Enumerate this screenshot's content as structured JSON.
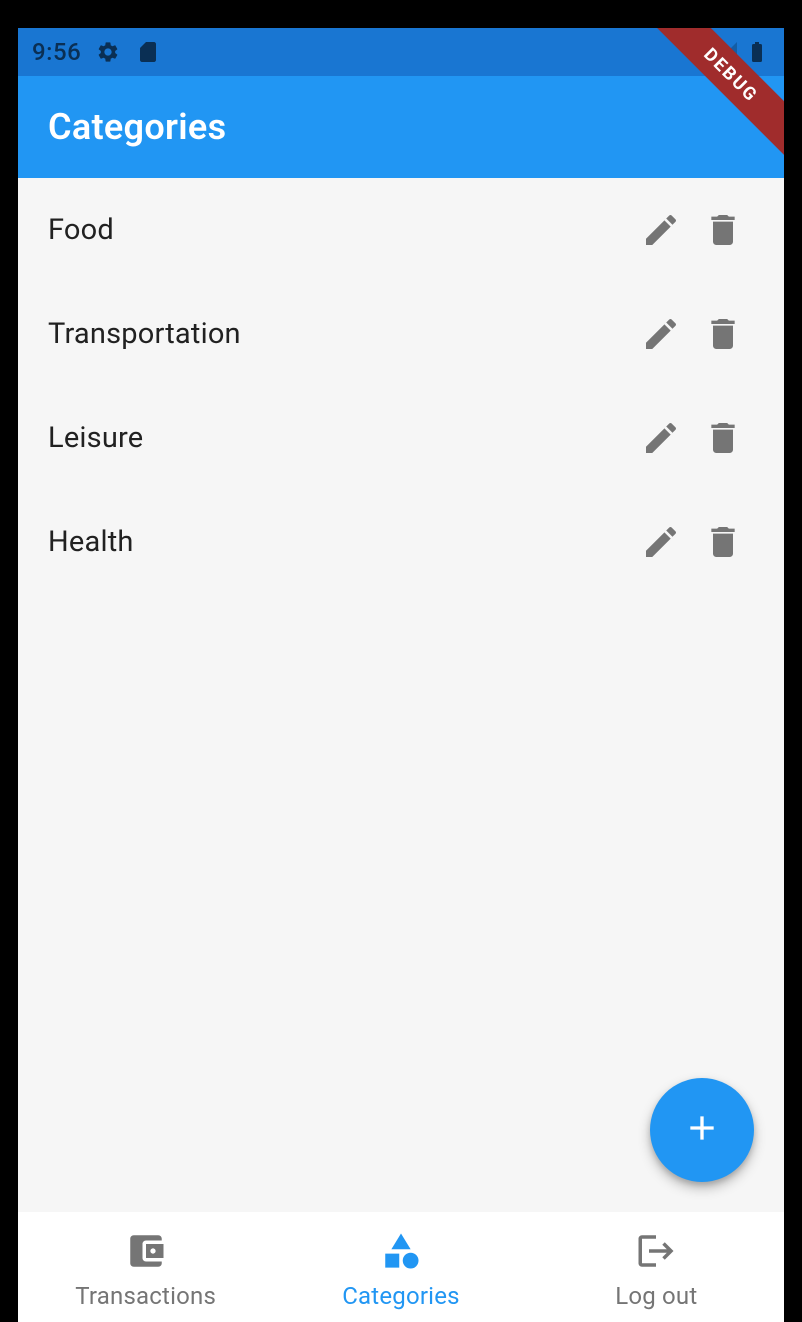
{
  "status_bar": {
    "time": "9:56"
  },
  "app_bar": {
    "title": "Categories"
  },
  "debug_banner": "DEBUG",
  "categories": [
    {
      "name": "Food"
    },
    {
      "name": "Transportation"
    },
    {
      "name": "Leisure"
    },
    {
      "name": "Health"
    }
  ],
  "bottom_nav": {
    "items": [
      {
        "label": "Transactions",
        "active": false
      },
      {
        "label": "Categories",
        "active": true
      },
      {
        "label": "Log out",
        "active": false
      }
    ]
  }
}
